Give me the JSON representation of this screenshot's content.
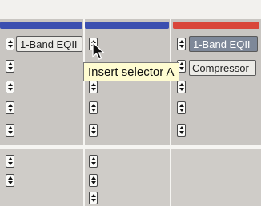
{
  "colors": {
    "track_blue": "#3b4fb0",
    "track_red": "#d9463a"
  },
  "insert_a": {
    "column_1_plugin": "1-Band EQII",
    "column_3_plugin": "1-Band EQII",
    "column_3_plugin_2": "Compressor"
  },
  "tooltip": {
    "text": "Insert selector A"
  },
  "icons": {
    "selector": "up-down-arrow-icon",
    "cursor": "mouse-pointer-icon"
  }
}
